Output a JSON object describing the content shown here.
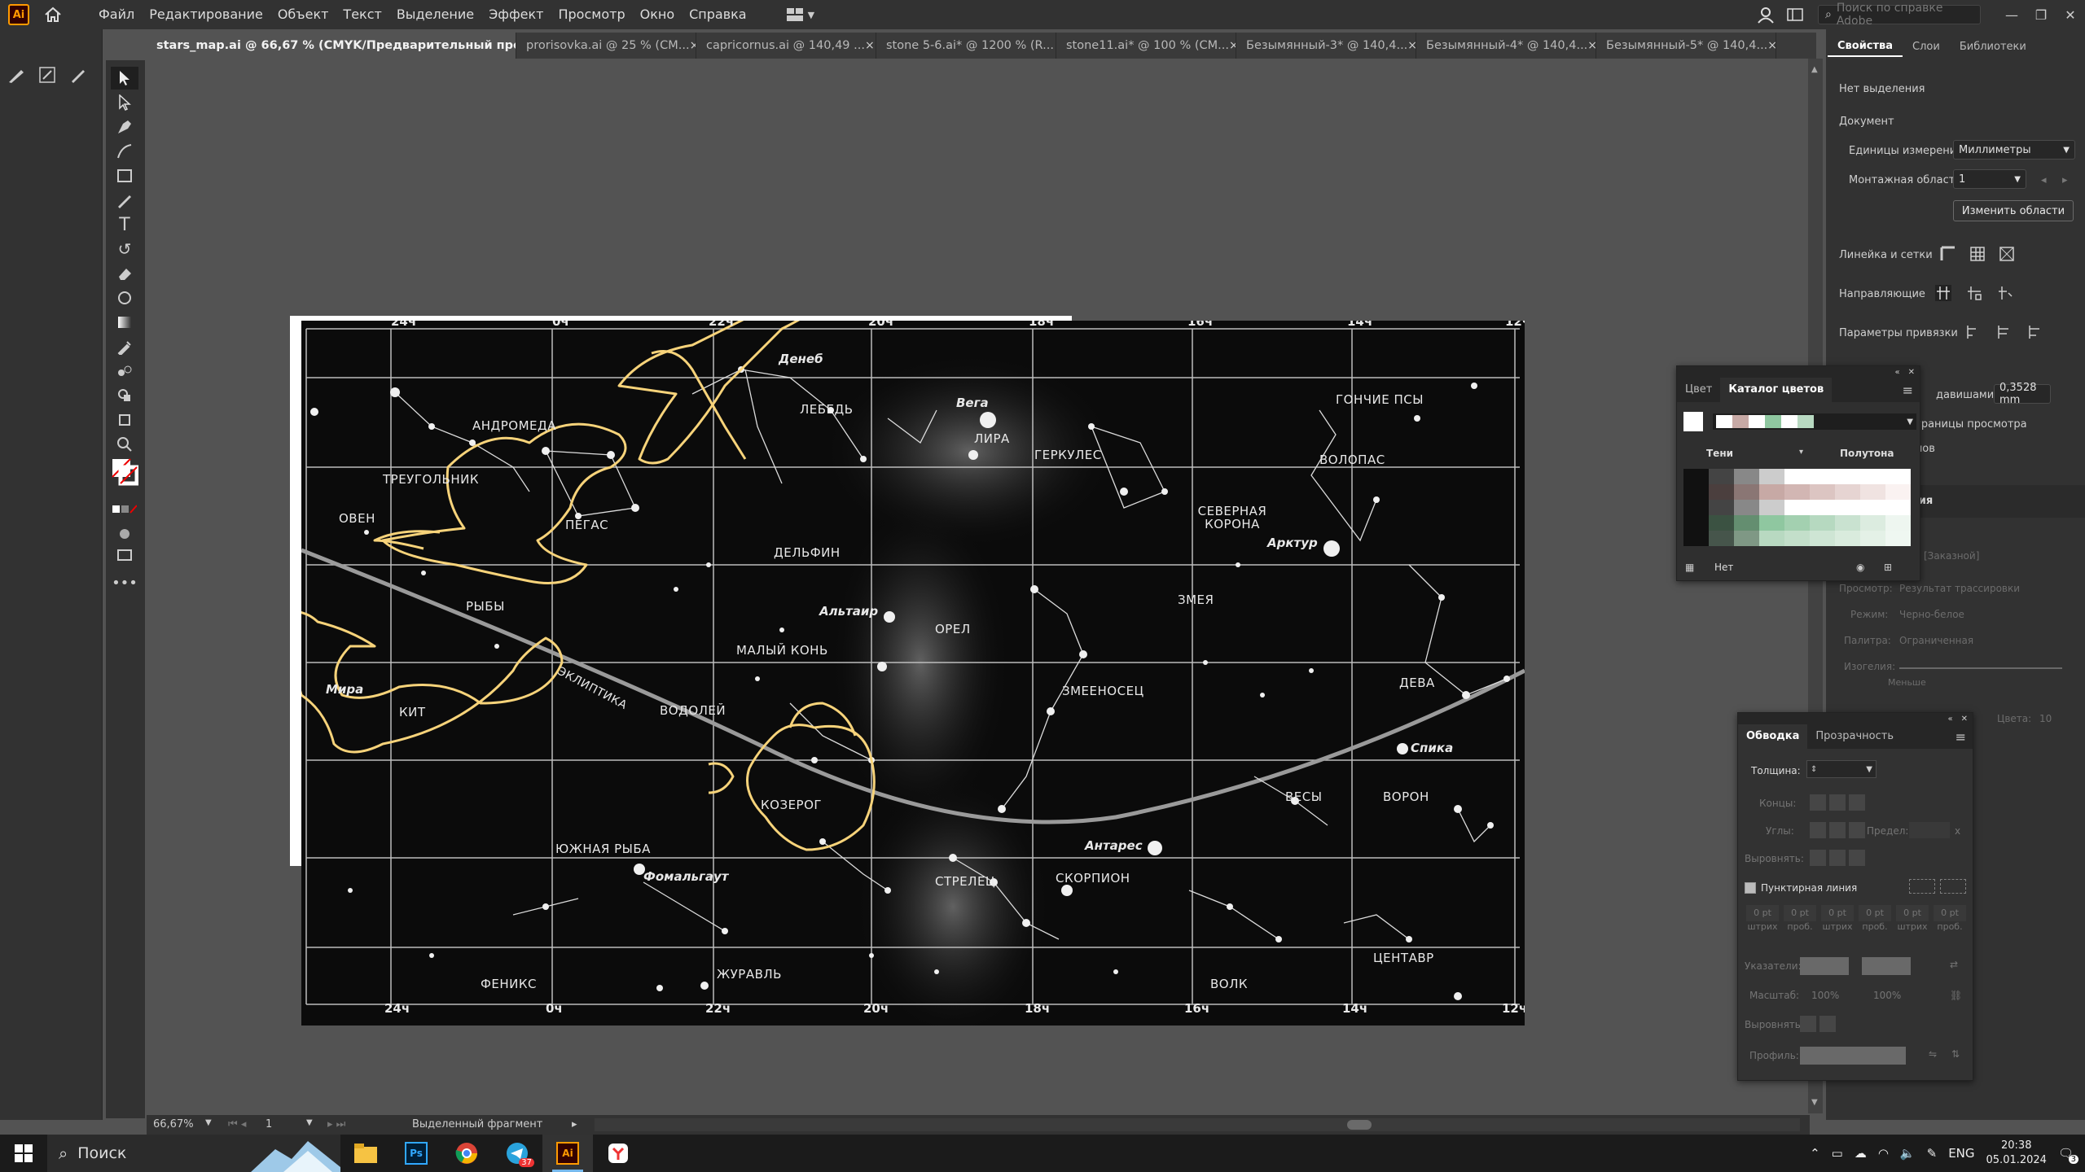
{
  "app": {
    "logo": "Ai"
  },
  "menu": [
    "Файл",
    "Редактирование",
    "Объект",
    "Текст",
    "Выделение",
    "Эффект",
    "Просмотр",
    "Окно",
    "Справка"
  ],
  "help_search": {
    "placeholder": "Поиск по справке Adobe"
  },
  "tabs": [
    {
      "label": "stars_map.ai @ 66,67 % (CMYK/Предварительный просмотр)",
      "active": true
    },
    {
      "label": "prorisovka.ai @ 25 % (CM..."
    },
    {
      "label": "capricornus.ai @ 140,49 ..."
    },
    {
      "label": "stone 5-6.ai* @ 1200 % (R..."
    },
    {
      "label": "stone11.ai* @ 100 % (CM..."
    },
    {
      "label": "Безымянный-3* @ 140,4..."
    },
    {
      "label": "Безымянный-4* @ 140,4..."
    },
    {
      "label": "Безымянный-5* @ 140,4..."
    }
  ],
  "tab_close_glyph": "×",
  "starmap": {
    "hours_top": [
      "24ч",
      "0ч",
      "22ч",
      "20ч",
      "18ч",
      "16ч",
      "14ч",
      "12ч"
    ],
    "hours_bottom": [
      "24ч",
      "0ч",
      "22ч",
      "20ч",
      "18ч",
      "16ч",
      "14ч",
      "12ч"
    ],
    "constellations": [
      "АНДРОМЕДА",
      "ТРЕУГОЛЬНИК",
      "ОВЕН",
      "РЫБЫ",
      "ПЕГАС",
      "ЛЕБЕДЬ",
      "ЛИРА",
      "ДЕЛЬФИН",
      "МАЛЫЙ КОНЬ",
      "ОРЕЛ",
      "ГЕРКУЛЕС",
      "СЕВЕРНАЯ КОРОНА",
      "ВОЛОПАС",
      "ГОНЧИЕ ПСЫ",
      "ЗМЕЯ",
      "ЗМЕЕНОСЕЦ",
      "ДЕВА",
      "КИТ",
      "ВОДОЛЕЙ",
      "КОЗЕРОГ",
      "ВЕСЫ",
      "ВОРОН",
      "ЮЖНАЯ РЫБА",
      "СТРЕЛЕЦ",
      "СКОРПИОН",
      "ФЕНИКС",
      "ЖУРАВЛЬ",
      "ВОЛК",
      "ЦЕНТАВР"
    ],
    "stars": [
      "Денеб",
      "Вега",
      "Альтаир",
      "Арктур",
      "Мира",
      "Спика",
      "Антарес",
      "Фомальгаут"
    ],
    "ecliptic": "ЭКЛИПТИКА"
  },
  "properties": {
    "tabs": [
      "Свойства",
      "Слои",
      "Библиотеки"
    ],
    "no_selection": "Нет выделения",
    "document": "Документ",
    "units_label": "Единицы измерения:",
    "units_value": "Миллиметры",
    "artboard_label": "Монтажная область:",
    "artboard_value": "1",
    "edit_artboards": "Изменить области",
    "rulers": "Линейка и сетки",
    "guides": "Направляющие",
    "snap": "Параметры привязки",
    "keyinc_label": "давишами:",
    "keyinc_value": "0,3528 mm",
    "bounds": "границы просмотра",
    "more": "лов",
    "trace_partial": "ения",
    "trace_preset": "[Заказной]",
    "trace_view_label": "Просмотр:",
    "trace_view": "Результат трассировки",
    "trace_mode_label": "Режим:",
    "trace_mode": "Черно-белое",
    "trace_palette_label": "Палитра:",
    "trace_palette": "Ограниченная",
    "trace_threshold_label": "Изогелия:",
    "trace_less": "Меньше",
    "trace_colors_label": "Цвета:",
    "trace_colors_value": "10"
  },
  "swatch_panel": {
    "tabs": [
      "Цвет",
      "Каталог цветов"
    ],
    "shades": "Тени",
    "tints": "Полутона",
    "none_label": "Нет"
  },
  "stroke_panel": {
    "tabs": [
      "Обводка",
      "Прозрачность"
    ],
    "weight_label": "Толщина:",
    "caps_label": "Концы:",
    "corners_label": "Углы:",
    "limit_label": "Предел:",
    "limit_unit": "x",
    "align_label": "Выровнять:",
    "dashed_label": "Пунктирная линия",
    "dash_values": [
      "0 pt",
      "0 pt",
      "0 pt",
      "0 pt",
      "0 pt",
      "0 pt"
    ],
    "dash_labels": [
      "штрих",
      "проб.",
      "штрих",
      "проб.",
      "штрих",
      "проб."
    ],
    "arrowheads_label": "Указатели:",
    "scale_label": "Масштаб:",
    "scale_values": [
      "100%",
      "100%"
    ],
    "align2_label": "Выровнять:",
    "profile_label": "Профиль:"
  },
  "statusbar": {
    "zoom": "66,67%",
    "artboard": "1",
    "info": "Выделенный фрагмент"
  },
  "taskbar": {
    "search": "Поиск",
    "telegram_badge": "37",
    "lang": "ENG",
    "time": "20:38",
    "date": "05.01.2024",
    "notif": "3"
  },
  "colors": {
    "accent_orange": "#ff9a00",
    "trace_yellow": "#f7d37a",
    "ui_dark": "#323232",
    "canvas": "#535353"
  }
}
